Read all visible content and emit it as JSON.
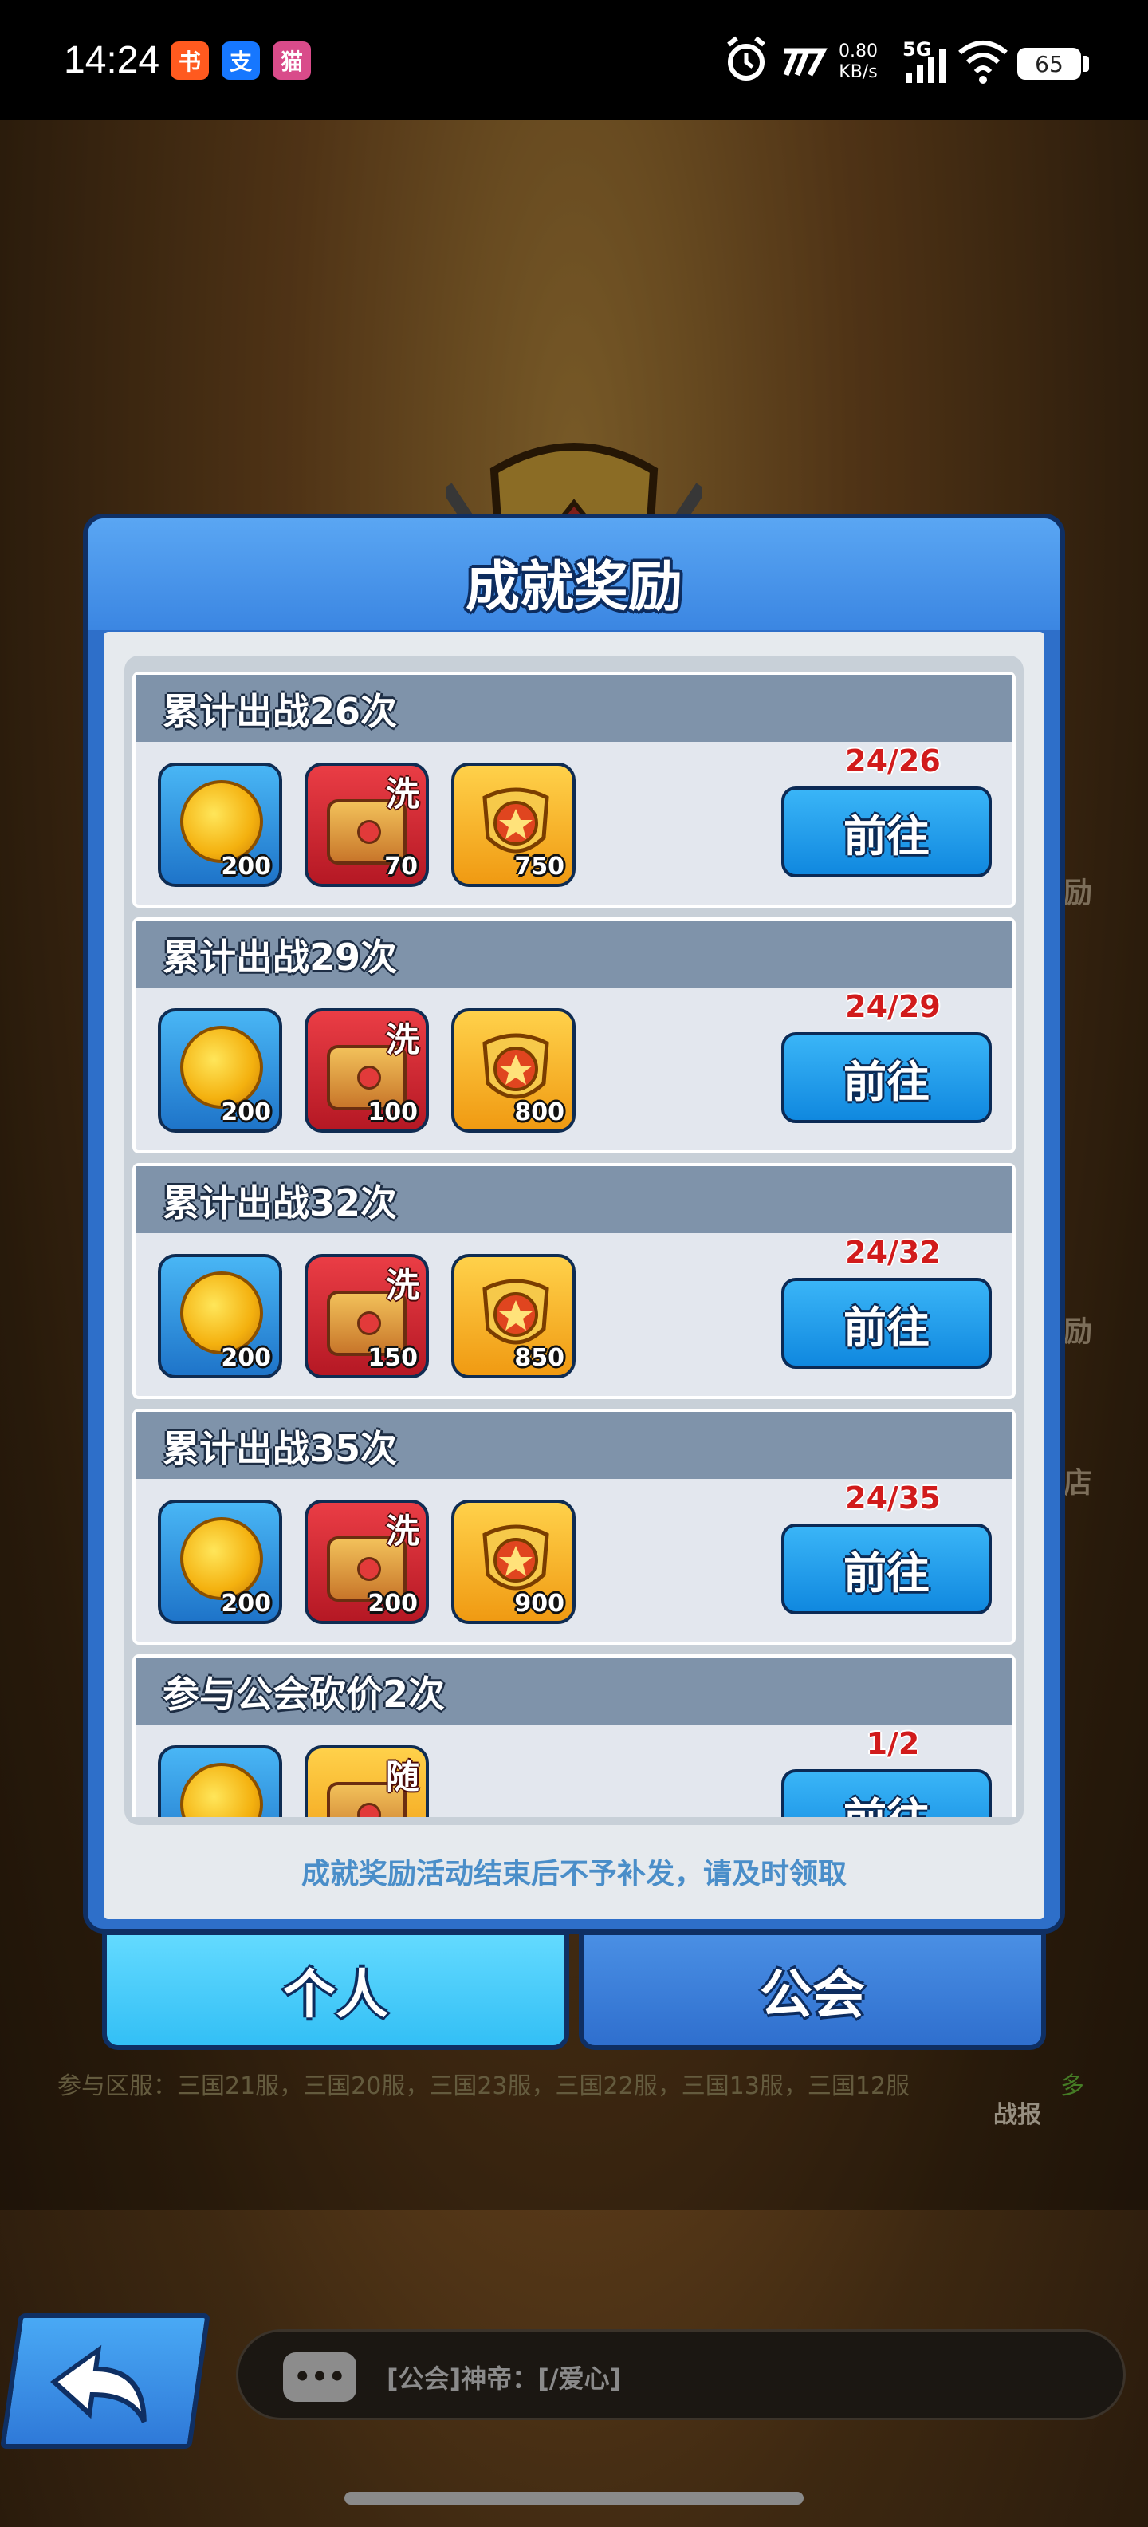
{
  "status_bar": {
    "time": "14:24",
    "apps": [
      {
        "icon": "xiaohongshu-app-icon",
        "glyph": "书",
        "color": "#ff5a1f"
      },
      {
        "icon": "alipay-app-icon",
        "glyph": "支",
        "color": "#1677ff"
      },
      {
        "icon": "game-app-icon",
        "glyph": "猫",
        "color": "#d94b8a"
      }
    ],
    "speed_value": "0.80",
    "speed_unit": "KB/s",
    "network": "5G",
    "battery": "65"
  },
  "modal": {
    "title": "成就奖励",
    "footer_note": "成就奖励活动结束后不予补发，请及时领取",
    "go_label": "前往",
    "cards": [
      {
        "title": "累计出战26次",
        "progress": "24/26",
        "rewards": [
          {
            "type": "coin",
            "qty": "200",
            "icon": "gold-coin-icon"
          },
          {
            "type": "chest",
            "qty": "70",
            "corner": "洗",
            "icon": "treasure-chest-icon"
          },
          {
            "type": "badge",
            "qty": "750",
            "icon": "star-shield-icon"
          }
        ]
      },
      {
        "title": "累计出战29次",
        "progress": "24/29",
        "rewards": [
          {
            "type": "coin",
            "qty": "200",
            "icon": "gold-coin-icon"
          },
          {
            "type": "chest",
            "qty": "100",
            "corner": "洗",
            "icon": "treasure-chest-icon"
          },
          {
            "type": "badge",
            "qty": "800",
            "icon": "star-shield-icon"
          }
        ]
      },
      {
        "title": "累计出战32次",
        "progress": "24/32",
        "rewards": [
          {
            "type": "coin",
            "qty": "200",
            "icon": "gold-coin-icon"
          },
          {
            "type": "chest",
            "qty": "150",
            "corner": "洗",
            "icon": "treasure-chest-icon"
          },
          {
            "type": "badge",
            "qty": "850",
            "icon": "star-shield-icon"
          }
        ]
      },
      {
        "title": "累计出战35次",
        "progress": "24/35",
        "rewards": [
          {
            "type": "coin",
            "qty": "200",
            "icon": "gold-coin-icon"
          },
          {
            "type": "chest",
            "qty": "200",
            "corner": "洗",
            "icon": "treasure-chest-icon"
          },
          {
            "type": "badge",
            "qty": "900",
            "icon": "star-shield-icon"
          }
        ]
      },
      {
        "title": "参与公会砍价2次",
        "progress": "1/2",
        "rewards": [
          {
            "type": "coin",
            "qty": "",
            "icon": "gold-coin-icon"
          },
          {
            "type": "chest-gold",
            "qty": "",
            "corner": "随",
            "icon": "treasure-chest-icon"
          }
        ]
      }
    ]
  },
  "tabs": {
    "personal": "个人",
    "guild": "公会"
  },
  "background": {
    "servers": "参与区服：三国21服，三国20服，三国23服，三国22服，三国13服，三国12服",
    "servers_more": "多",
    "side_labels": [
      "励",
      "励",
      "店"
    ],
    "report_label": "战报"
  },
  "chat": {
    "text": "[公会]神帝：[/爱心]",
    "icon_glyph": "•••"
  }
}
